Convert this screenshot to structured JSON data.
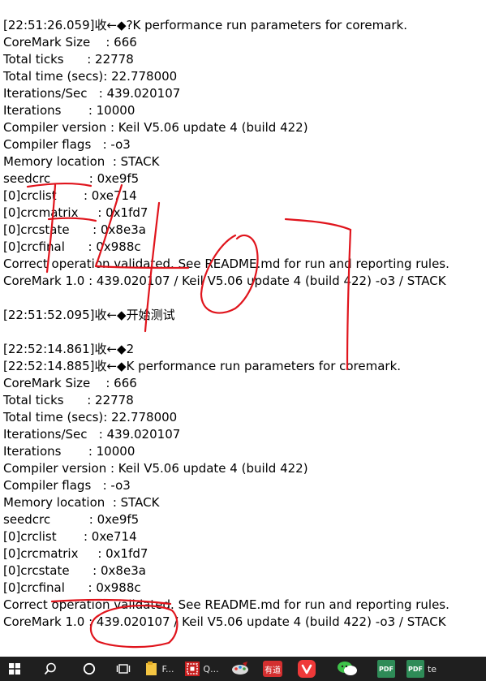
{
  "log_lines": [
    "[22:51:26.059]收←◆?K performance run parameters for coremark.",
    "CoreMark Size    : 666",
    "Total ticks      : 22778",
    "Total time (secs): 22.778000",
    "Iterations/Sec   : 439.020107",
    "Iterations       : 10000",
    "Compiler version : Keil V5.06 update 4 (build 422)",
    "Compiler flags   : -o3",
    "Memory location  : STACK",
    "seedcrc          : 0xe9f5",
    "[0]crclist       : 0xe714",
    "[0]crcmatrix     : 0x1fd7",
    "[0]crcstate      : 0x8e3a",
    "[0]crcfinal      : 0x988c",
    "Correct operation validated. See README.md for run and reporting rules.",
    "CoreMark 1.0 : 439.020107 / Keil V5.06 update 4 (build 422) -o3 / STACK",
    "",
    "[22:51:52.095]收←◆开始测试",
    "",
    "[22:52:14.861]收←◆2",
    "[22:52:14.885]收←◆K performance run parameters for coremark.",
    "CoreMark Size    : 666",
    "Total ticks      : 22778",
    "Total time (secs): 22.778000",
    "Iterations/Sec   : 439.020107",
    "Iterations       : 10000",
    "Compiler version : Keil V5.06 update 4 (build 422)",
    "Compiler flags   : -o3",
    "Memory location  : STACK",
    "seedcrc          : 0xe9f5",
    "[0]crclist       : 0xe714",
    "[0]crcmatrix     : 0x1fd7",
    "[0]crcstate      : 0x8e3a",
    "[0]crcfinal      : 0x988c",
    "Correct operation validated. See README.md for run and reporting rules.",
    "CoreMark 1.0 : 439.020107 / Keil V5.06 update 4 (build 422) -o3 / STACK"
  ],
  "annotation": {
    "handwriting": "F407",
    "ink_color": "#e0141c"
  },
  "taskbar": {
    "explorer_label": "F...",
    "app2_label": "Q...",
    "youdao_label": "有道",
    "pdf1_label": "PDF",
    "pdf2_label": "PDF",
    "last_label": "te",
    "icons": [
      "windows-start-icon",
      "search-icon",
      "cortana-icon",
      "task-view-icon",
      "file-explorer-icon",
      "app-q-icon",
      "paint-icon",
      "youdao-icon",
      "vivaldi-icon",
      "wechat-icon",
      "pdf-icon",
      "pdf-icon"
    ]
  }
}
